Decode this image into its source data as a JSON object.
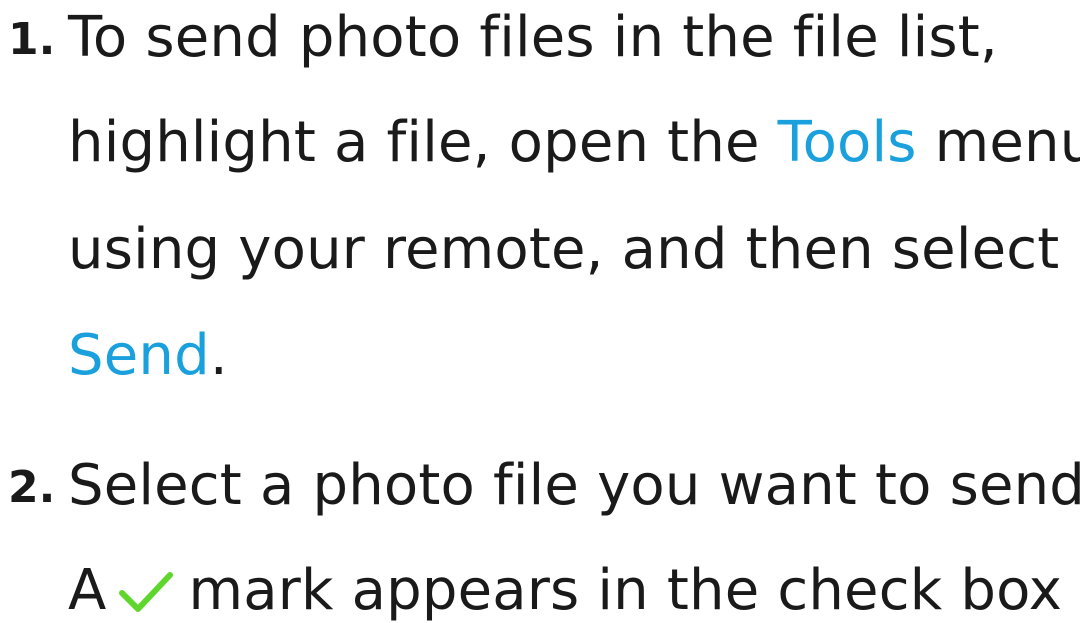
{
  "steps": [
    {
      "number": "1.",
      "lines": [
        {
          "text": "To send photo files in the file list,"
        },
        {
          "before": "highlight a file, open the ",
          "highlight": "Tools",
          "after": " menu"
        },
        {
          "text": "using your remote, and then select"
        },
        {
          "highlight": "Send",
          "after": "."
        }
      ]
    },
    {
      "number": "2.",
      "lines": [
        {
          "text": "Select a photo file you want to send."
        },
        {
          "before": "A",
          "icon": "checkmark-icon",
          "after": "mark appears in the check box"
        }
      ]
    }
  ],
  "colors": {
    "text": "#1a1a1a",
    "highlight": "#1aa0dc",
    "checkmark": "#5fd62c"
  }
}
